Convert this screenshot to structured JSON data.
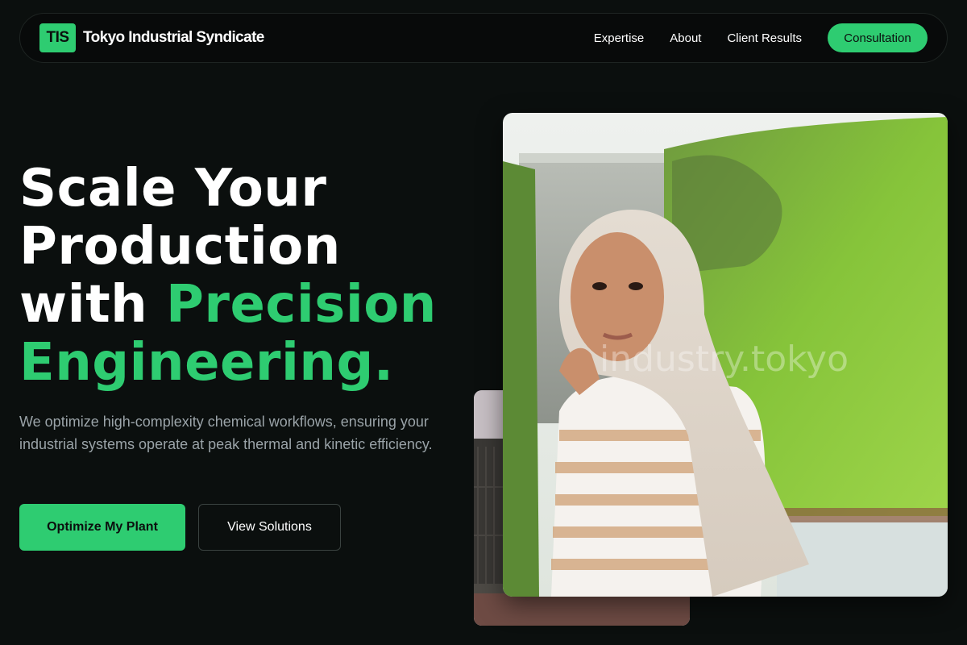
{
  "brand": {
    "logo_text": "TIS",
    "name": "Tokyo Industrial Syndicate"
  },
  "nav": {
    "links": [
      "Expertise",
      "About",
      "Client Results"
    ],
    "cta": "Consultation"
  },
  "hero": {
    "title_line1": "Scale Your",
    "title_line2": "Production",
    "title_line3_plain": "with ",
    "title_line3_accent": "Precision",
    "title_line4_accent": "Engineering.",
    "description": "We optimize high-complexity chemical workflows, ensuring your industrial systems operate at peak thermal and kinetic efficiency.",
    "primary_button": "Optimize My Plant",
    "secondary_button": "View Solutions"
  },
  "images": {
    "main_watermark": "industry.tokyo"
  },
  "colors": {
    "background": "#0b0f0e",
    "accent": "#2ecc71",
    "muted_text": "#9aa3a8"
  }
}
